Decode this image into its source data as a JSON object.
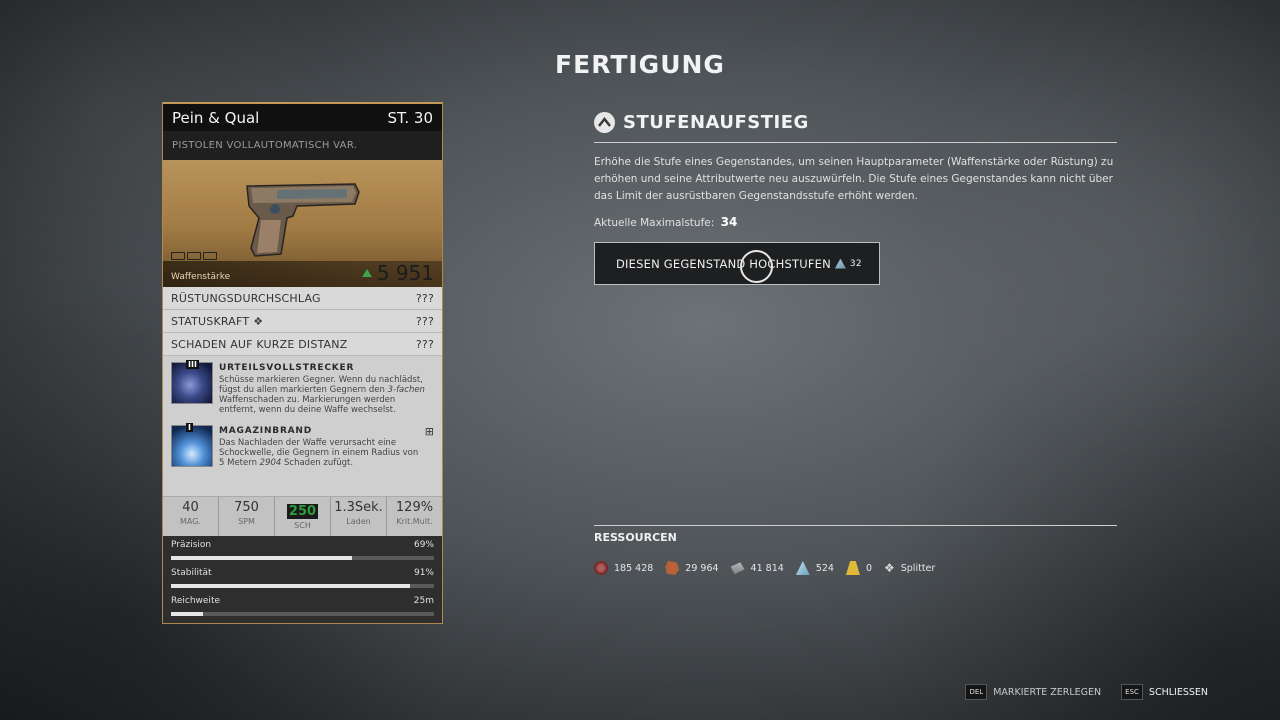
{
  "page_title": "FERTIGUNG",
  "item": {
    "name": "Pein & Qual",
    "level": "ST. 30",
    "type": "PISTOLEN VOLLAUTOMATISCH VAR.",
    "power_label": "Waffenstärke",
    "power_value": "5 951",
    "attributes": [
      {
        "label": "RÜSTUNGSDURCHSCHLAG",
        "value": "???"
      },
      {
        "label": "STATUSKRAFT",
        "value": "???"
      },
      {
        "label": "SCHADEN AUF KURZE DISTANZ",
        "value": "???"
      }
    ],
    "mods": [
      {
        "tier": "III",
        "title": "URTEILSVOLLSTRECKER",
        "desc_parts": [
          "Schüsse markieren Gegner. Wenn du nachlädst, fügst du allen markierten Gegnern den ",
          "3-fachen",
          " Waffenschaden zu. Markierungen werden entfernt, wenn du deine Waffe wechselst."
        ]
      },
      {
        "tier": "I",
        "title": "MAGAZINBRAND",
        "desc_parts": [
          "Das Nachladen der Waffe verursacht eine Schockwelle, die Gegnern in einem Radius von 5 Metern ",
          "2904",
          " Schaden zufügt."
        ]
      }
    ],
    "stats": [
      {
        "value": "40",
        "label": "MAG."
      },
      {
        "value": "750",
        "label": "SPM"
      },
      {
        "value": "250",
        "label": "SCH"
      },
      {
        "value": "1.3Sek.",
        "label": "Laden"
      },
      {
        "value": "129%",
        "label": "Krit.Mult."
      }
    ],
    "bars": [
      {
        "label": "Präzision",
        "value": "69%",
        "fill": 0.69
      },
      {
        "label": "Stabilität",
        "value": "91%",
        "fill": 0.91
      },
      {
        "label": "Reichweite",
        "value": "25m",
        "fill": 0.12
      }
    ]
  },
  "upgrade": {
    "title": "STUFENAUFSTIEG",
    "description": "Erhöhe die Stufe eines Gegenstandes, um seinen Hauptparameter (Waffenstärke oder Rüstung) zu erhöhen und seine Attributwerte neu auszuwürfeln. Die Stufe eines Gegenstandes kann nicht über das Limit der ausrüstbaren Gegenstandsstufe erhöht werden.",
    "max_level_label": "Aktuelle Maximalstufe:",
    "max_level_value": "34",
    "button_label": "DIESEN GEGENSTAND HOCHSTUFEN",
    "button_cost": "32"
  },
  "resources": {
    "title": "RESSOURCEN",
    "items": [
      {
        "icon": "scrap-icon",
        "value": "185 428"
      },
      {
        "icon": "leather-icon",
        "value": "29 964"
      },
      {
        "icon": "iron-icon",
        "value": "41 814"
      },
      {
        "icon": "titanium-icon",
        "value": "524"
      },
      {
        "icon": "anomalous-icon",
        "value": "0"
      },
      {
        "icon": "shard-icon",
        "value": "Splitter"
      }
    ]
  },
  "footer": {
    "del_key": "DEL",
    "del_label": "MARKIERTE ZERLEGEN",
    "esc_key": "ESC",
    "esc_label": "SCHLIESSEN"
  },
  "colors": {
    "card_border": "#c39a55",
    "power_up": "#3aa54a",
    "damage_highlight": "#2e9c3a"
  }
}
